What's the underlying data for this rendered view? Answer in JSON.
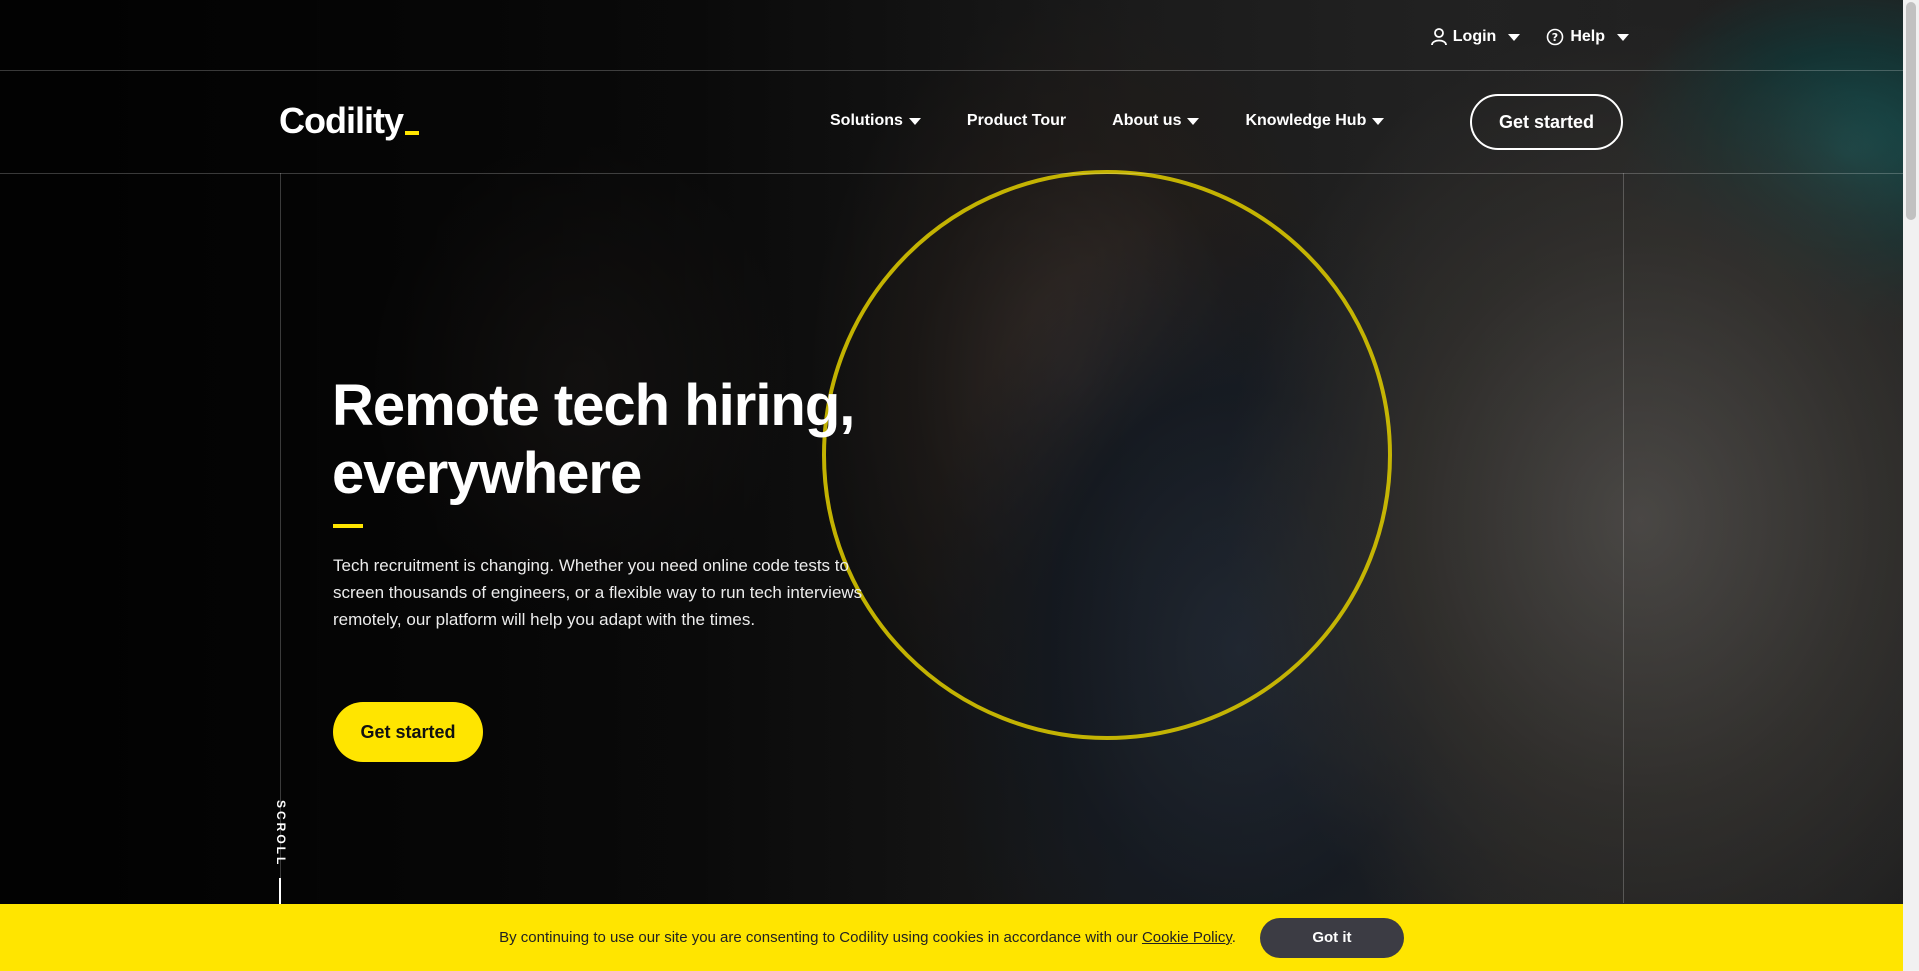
{
  "utility_bar": {
    "login_label": "Login",
    "help_label": "Help"
  },
  "nav": {
    "logo_text": "Codility",
    "items": [
      {
        "label": "Solutions",
        "has_dropdown": true
      },
      {
        "label": "Product Tour",
        "has_dropdown": false
      },
      {
        "label": "About us",
        "has_dropdown": true
      },
      {
        "label": "Knowledge Hub",
        "has_dropdown": true
      }
    ],
    "cta_label": "Get started"
  },
  "hero": {
    "headline_line1": "Remote tech hiring,",
    "headline_line2": "everywhere",
    "lead": "Tech recruitment is changing. Whether you need online code tests to screen thousands of engineers, or a flexible way to run tech interviews remotely, our platform will help you adapt with the times.",
    "cta_label": "Get started",
    "scroll_label": "SCROLL"
  },
  "cookie_bar": {
    "text_before": "By continuing to use our site you are consenting to Codility using cookies in accordance with our ",
    "link_text": "Cookie Policy",
    "text_after": ".",
    "button_label": "Got it"
  },
  "colors": {
    "accent_yellow": "#ffe500",
    "cookie_button": "#3c3c44"
  }
}
